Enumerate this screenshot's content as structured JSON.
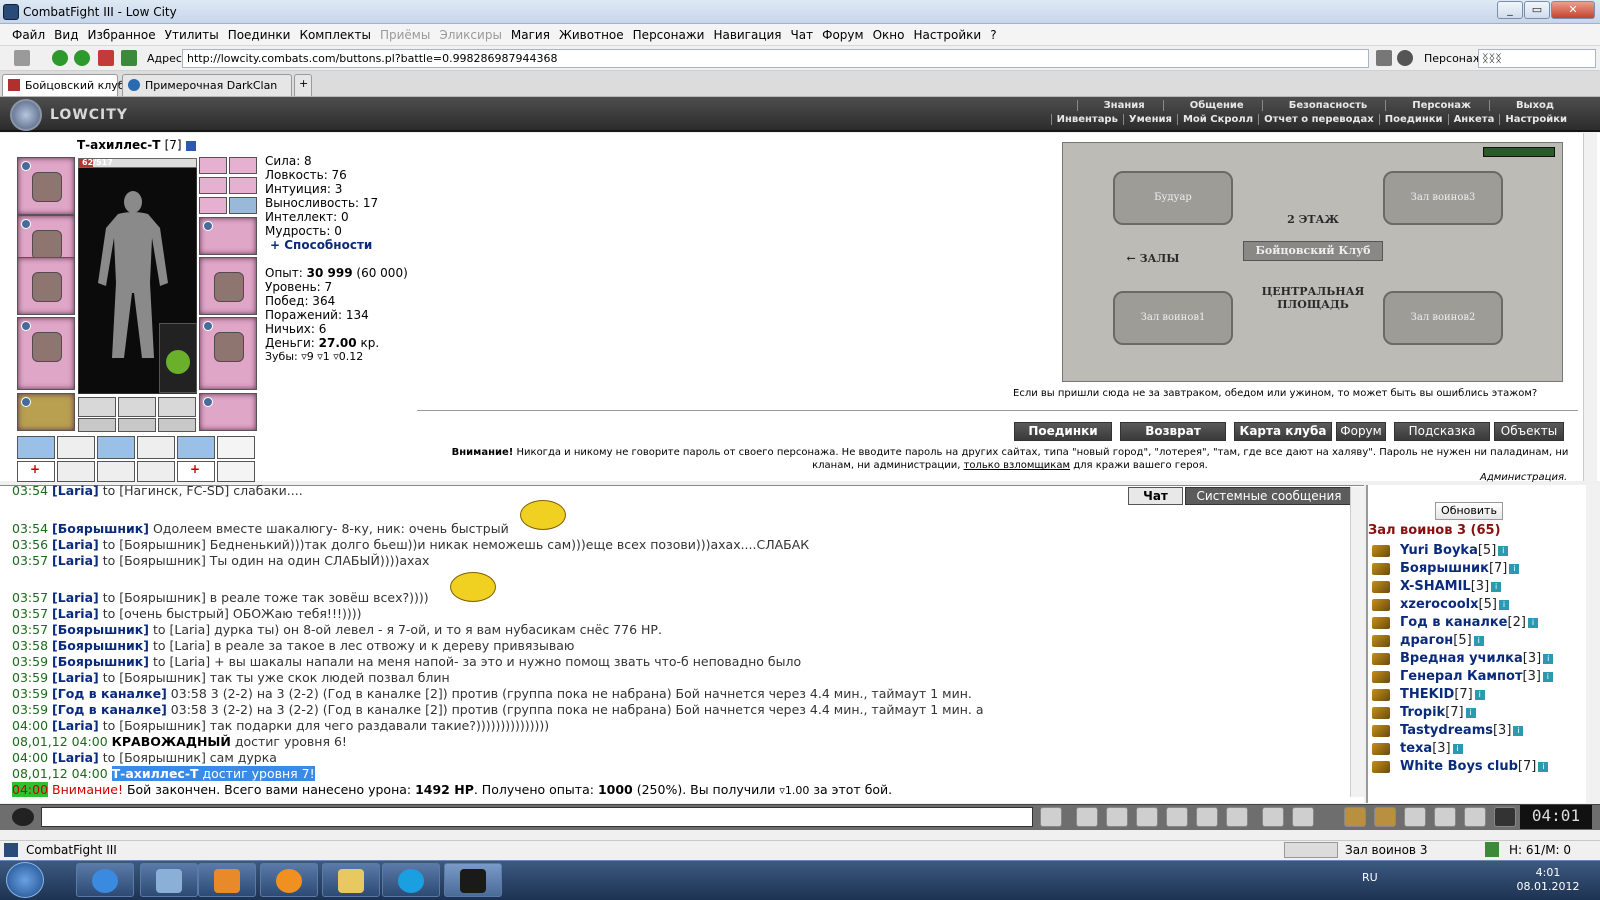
{
  "window": {
    "title": "CombatFight III - Low City"
  },
  "menu": [
    "Файл",
    "Вид",
    "Избранное",
    "Утилиты",
    "Поединки",
    "Комплекты",
    "Приёмы",
    "Эликсиры",
    "Магия",
    "Животное",
    "Персонажи",
    "Навигация",
    "Чат",
    "Форум",
    "Окно",
    "Настройки",
    "?"
  ],
  "menu_disabled": [
    "Приёмы",
    "Эликсиры"
  ],
  "address": {
    "label": "Адрес:",
    "url": "http://lowcity.combats.com/buttons.pl?battle=0.998286987944368",
    "persona_label": "Персонаж:",
    "persona_value": "ᛝᛝᛝ"
  },
  "tabs": [
    {
      "label": "Бойцовский клуб"
    },
    {
      "label": "Примерочная DarkClan"
    }
  ],
  "header": {
    "logo": "LOWCITY",
    "nav1": [
      "Знания",
      "Общение",
      "Безопасность",
      "Персонаж",
      "Выход"
    ],
    "nav2": [
      "Инвентарь",
      "Умения",
      "Мой Скролл",
      "Отчет о переводах",
      "Поединки",
      "Анкета",
      "Настройки"
    ]
  },
  "character": {
    "name": "Т-ахиллес-Т",
    "level": "[7]",
    "hp": "62/517",
    "hp_fraction": 0.12,
    "stats": {
      "strength": "Сила: 8",
      "agility": "Ловкость: 76",
      "intuition": "Интуиция: 3",
      "endurance": "Выносливость: 17",
      "intellect": "Интеллект: 0",
      "wisdom": "Мудрость: 0",
      "abilities": "+ Способности"
    },
    "exp_label": "Опыт:",
    "exp_value": "30 999",
    "exp_next": "(60 000)",
    "level_line": "Уровень: 7",
    "wins": "Побед: 364",
    "losses": "Поражений: 134",
    "draws": "Ничьих: 6",
    "money_label": "Деньги:",
    "money_value": "27.00",
    "money_unit": "кр.",
    "teeth": "Зубы: ▿9 ▿1 ▿0.12"
  },
  "map": {
    "rooms": {
      "boudoir": "Будуар",
      "hall3": "Зал воинов3",
      "hall1": "Зал воинов1",
      "hall2": "Зал воинов2"
    },
    "floor": "2 ЭТАЖ",
    "club": "Бойцовский Клуб",
    "halls": "← ЗАЛЫ",
    "square": "ЦЕНТРАЛЬНАЯ ПЛОЩАДЬ",
    "caption": "Если вы пришли сюда не за завтраком, обедом или ужином, то может быть вы ошиблись этажом?"
  },
  "actions": [
    "Поединки",
    "Возврат",
    "Карта клуба",
    "Форум",
    "Подсказка",
    "Объекты"
  ],
  "warning": {
    "bold": "Внимание!",
    "text": " Никогда и никому не говорите пароль от своего персонажа. Не вводите пароль на других сайтах, типа \"новый город\", \"лотерея\", \"там, где все дают на халяву\". Пароль не нужен ни паладинам, ни кланам, ни администрации, ",
    "link": "только взломщикам",
    "tail": " для кражи вашего героя.",
    "sign": "Администрация."
  },
  "chat": {
    "tabs": [
      "Чат",
      "Системные сообщения"
    ],
    "lines": [
      {
        "time": "03:54",
        "nick": "[Laria]",
        "rest": " to [Нагинск, FC-SD] слабаки...."
      },
      {
        "time": "03:54",
        "nick": "[Боярышник]",
        "rest": " Одолеем вместе шакалюгу- 8-ку, ник: очень быстрый"
      },
      {
        "time": "03:56",
        "nick": "[Laria]",
        "rest": " to [Боярышник] Бедненький)))так долго бьеш))и никак неможешь сам)))еще всех позови)))ахах....СЛАБАК"
      },
      {
        "time": "03:57",
        "nick": "[Laria]",
        "rest": " to [Боярышник] Ты один на один СЛАБЫЙ))))ахах"
      },
      {
        "time": "03:57",
        "nick": "[Laria]",
        "rest": " to [Боярышник] в реале тоже так зовёш всех?))))"
      },
      {
        "time": "03:57",
        "nick": "[Laria]",
        "rest": " to [очень быстрый] ОБОЖаю тебя!!!))))"
      },
      {
        "time": "03:57",
        "nick": "[Боярышник]",
        "rest": " to [Laria] дурка ты) он 8-ой левел - я 7-ой, и то я вам нубасикам снёс 776 НР."
      },
      {
        "time": "03:58",
        "nick": "[Боярышник]",
        "rest": " to [Laria] в реале за такое в лес отвожу и к дереву привязываю"
      },
      {
        "time": "03:59",
        "nick": "[Боярышник]",
        "rest": " to [Laria] + вы шакалы напали на меня напой- за это и нужно помощ звать что-б неповадно было"
      },
      {
        "time": "03:59",
        "nick": "[Laria]",
        "rest": " to [Боярышник] так ты уже скок людей позвал блин"
      },
      {
        "time": "03:59",
        "nick": "[Год в каналке]",
        "rest": " 03:58 3 (2-2) на 3 (2-2) (Год в каналке [2]) против (группа пока не набрана) Бой начнется через 4.4 мин., таймаут 1 мин."
      },
      {
        "time": "03:59",
        "nick": "[Год в каналке]",
        "rest": " 03:58 3 (2-2) на 3 (2-2) (Год в каналке [2]) против (группа пока не набрана) Бой начнется через 4.4 мин., таймаут 1 мин. а"
      },
      {
        "time": "04:00",
        "nick": "[Laria]",
        "rest": " to [Боярышник] так подарки для чего раздавали такие?)))))))))))))))"
      },
      {
        "time": "08,01,12 04:00",
        "nick": "КРАВОЖАДНЫЙ",
        "rest": " достиг уровня 6!"
      },
      {
        "time": "04:00",
        "nick": "[Laria]",
        "rest": " to [Боярышник] сам дурка"
      },
      {
        "time": "08,01,12 04:00",
        "nick": "Т-ахиллес-Т",
        "rest": " достиг уровня 7!"
      }
    ],
    "final": {
      "time": "04:00",
      "alert": "Внимание!",
      "t1": " Бой закончен. Всего вами нанесено урона: ",
      "dmg": "1492 HP",
      "t2": ". Получено опыта: ",
      "exp": "1000",
      "t3": " (250%). Вы получили ",
      "coin": "▿1.00",
      "t4": " за этот бой."
    }
  },
  "online": {
    "refresh": "Обновить",
    "room": "Зал воинов 3 (65)",
    "players": [
      {
        "nick": "Yuri Boyka",
        "level": "[5]"
      },
      {
        "nick": "Боярышник",
        "level": "[7]"
      },
      {
        "nick": "X-SHAMIL",
        "level": "[3]"
      },
      {
        "nick": "xzerocoolx",
        "level": "[5]"
      },
      {
        "nick": "Год в каналке",
        "level": "[2]"
      },
      {
        "nick": "драгон",
        "level": "[5]"
      },
      {
        "nick": "Вредная училка",
        "level": "[3]"
      },
      {
        "nick": "Генерал Кампот",
        "level": "[3]"
      },
      {
        "nick": "THEKID",
        "level": "[7]"
      },
      {
        "nick": "Tropik",
        "level": "[7]"
      },
      {
        "nick": "Tastydreams",
        "level": "[3]"
      },
      {
        "nick": "texa",
        "level": "[3]"
      },
      {
        "nick": "White Boys club",
        "level": "[7]"
      }
    ]
  },
  "clock": "04:01",
  "status": {
    "app": "CombatFight III",
    "location": "Зал воинов 3",
    "hm": "H: 61/M: 0"
  },
  "taskbar": {
    "lang": "RU",
    "time": "4:01",
    "date": "08.01.2012"
  }
}
